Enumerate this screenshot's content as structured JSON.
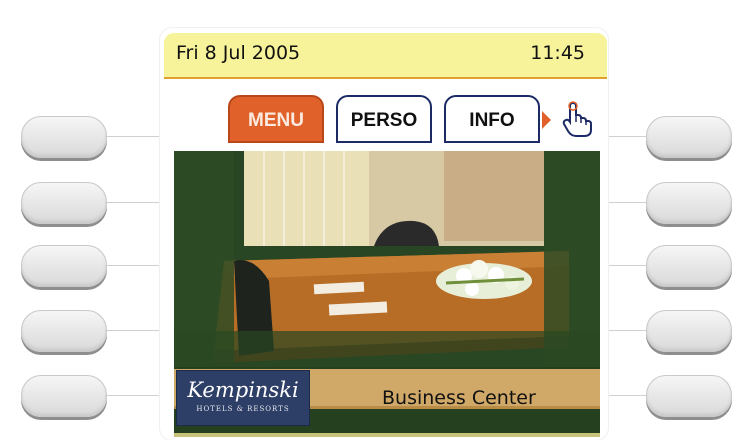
{
  "status_bar": {
    "date": "Fri 8 Jul 2005",
    "time": "11:45"
  },
  "tabs": [
    {
      "label": "MENU",
      "active": true
    },
    {
      "label": "PERSO",
      "active": false
    },
    {
      "label": "INFO",
      "active": false
    }
  ],
  "icons": {
    "scroll_right": "triangle-right-icon",
    "hand": "hand-pointer-icon"
  },
  "content": {
    "logo": {
      "brand": "Kempinski",
      "subline": "HOTELS & RESORTS"
    },
    "label": "Business Center"
  },
  "colors": {
    "status_bar_bg": "#f7f39a",
    "tab_active": "#e0622a",
    "tab_border": "#1c2a66",
    "content_bg": "#24401e",
    "label_bg": "#d0a968",
    "logo_bg": "#2d3f66"
  }
}
